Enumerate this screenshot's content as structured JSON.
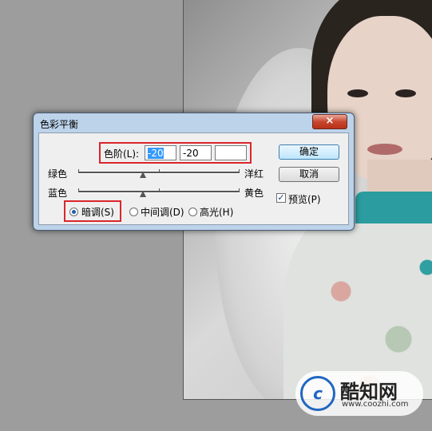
{
  "dialog": {
    "title": "色彩平衡",
    "close_glyph": "×",
    "levels_label": "色阶(L):",
    "levels": [
      "-20",
      "-20",
      ""
    ],
    "sliders": [
      {
        "left": "绿色",
        "right": "洋红",
        "value": 0
      },
      {
        "left": "蓝色",
        "right": "黄色",
        "value": 0
      }
    ],
    "tone": {
      "shadows": "暗调(S)",
      "midtones": "中间调(D)",
      "highlights": "高光(H)",
      "selected": "shadows"
    },
    "ok": "确定",
    "cancel": "取消",
    "preview": "预览(P)",
    "preview_checked": true
  },
  "watermark": {
    "brand": "酷知网",
    "url": "www.coozhi.com",
    "mark": "c"
  },
  "colors": {
    "highlight_box": "#d9262b",
    "selection": "#3399ff"
  },
  "icons": {
    "close": "close-icon",
    "check": "checkmark-icon",
    "logo": "coozhi-logo-icon"
  }
}
